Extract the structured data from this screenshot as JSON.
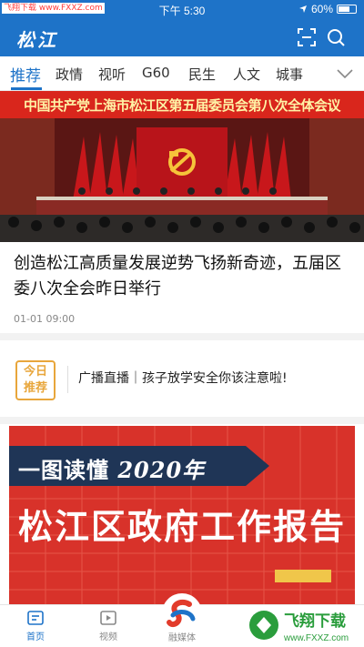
{
  "status_bar": {
    "watermark": "飞翔下载 www.FXXZ.com",
    "time": "下午 5:30",
    "battery": "60%"
  },
  "header": {
    "logo": "松江",
    "icons": [
      "scan-icon",
      "search-icon"
    ]
  },
  "tabs": [
    {
      "label": "推荐",
      "active": true
    },
    {
      "label": "政情"
    },
    {
      "label": "视听"
    },
    {
      "label": "G60"
    },
    {
      "label": "民生"
    },
    {
      "label": "人文"
    },
    {
      "label": "城事"
    }
  ],
  "hero": {
    "banner": "中国共产党上海市松江区第五届委员会第八次全体会议",
    "headline": "创造松江高质量发展逆势飞扬新奇迹，五届区委八次全会昨日举行",
    "date": "01-01 09:00"
  },
  "today": {
    "badge": "今日推荐",
    "badge_line1": "今日",
    "badge_line2": "推荐",
    "text": "广播直播｜孩子放学安全你该注意啦!"
  },
  "poster": {
    "line1_prefix": "一图读懂 ",
    "line1_year": "2020年",
    "line2": "松江区政府工作报告"
  },
  "bottom_nav": [
    {
      "label": "首页",
      "icon": "home-icon",
      "active": true
    },
    {
      "label": "视频",
      "icon": "video-icon"
    },
    {
      "label": "融媒体",
      "icon": "media-logo-icon"
    },
    {
      "label": "",
      "icon": "obscured-icon"
    },
    {
      "label": "",
      "icon": "obscured-icon"
    }
  ],
  "corner_watermark": {
    "text": "飞翔下载",
    "url": "www.FXXZ.com"
  },
  "colors": {
    "brand_blue": "#1e73c8",
    "banner_red": "#d9261c",
    "badge_orange": "#e8a63b"
  }
}
